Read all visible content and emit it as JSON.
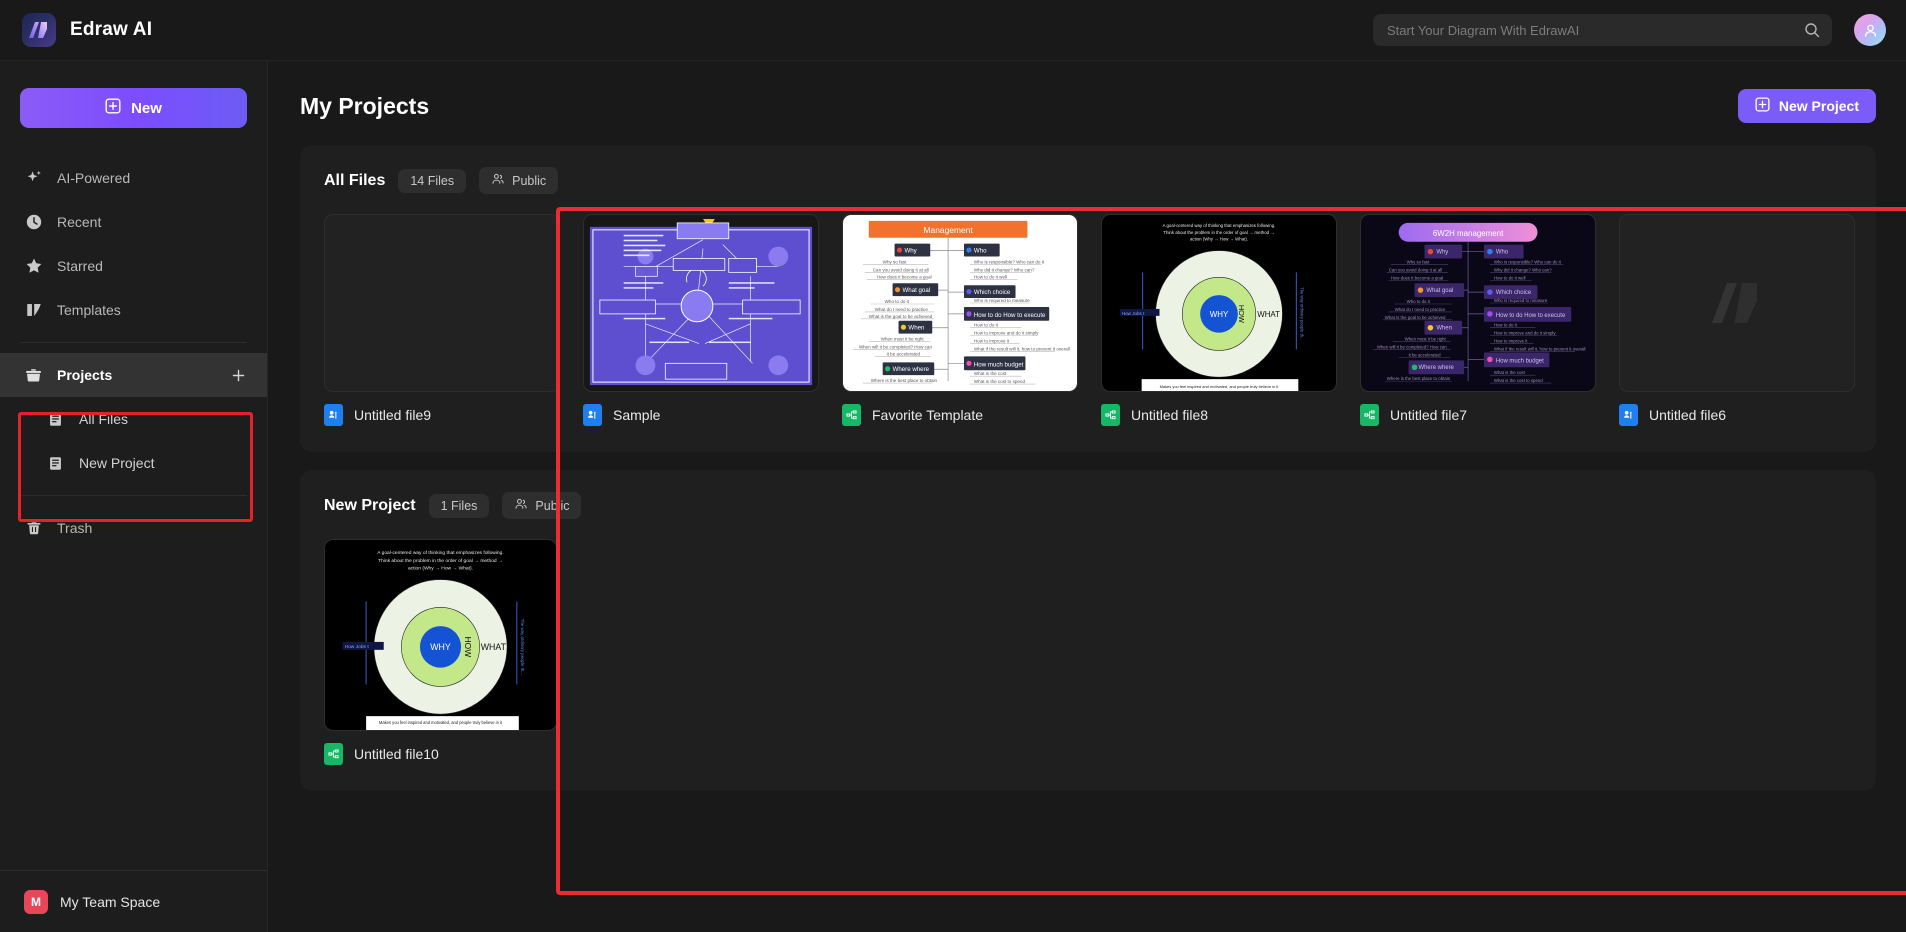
{
  "app": {
    "brand_name": "Edraw AI",
    "logo_icon": "edraw-logo-icon"
  },
  "header": {
    "search": {
      "placeholder": "Start Your Diagram With EdrawAI",
      "value": "",
      "icon": "search-icon"
    },
    "avatar_icon": "user-avatar-icon"
  },
  "sidebar": {
    "new_button": {
      "label": "New",
      "icon": "plus-box-icon"
    },
    "items": [
      {
        "label": "AI-Powered",
        "icon": "sparkle-icon",
        "active": false
      },
      {
        "label": "Recent",
        "icon": "clock-icon",
        "active": false
      },
      {
        "label": "Starred",
        "icon": "star-icon",
        "active": false
      },
      {
        "label": "Templates",
        "icon": "templates-icon",
        "active": false
      }
    ],
    "projects": {
      "label": "Projects",
      "icon": "folder-icon",
      "add_icon": "plus-icon",
      "active": true,
      "children": [
        {
          "label": "All Files",
          "icon": "file-list-icon"
        },
        {
          "label": "New Project",
          "icon": "file-list-icon"
        }
      ]
    },
    "trash": {
      "label": "Trash",
      "icon": "trash-icon"
    },
    "team": {
      "badge": "M",
      "label": "My Team Space"
    }
  },
  "main": {
    "page_title": "My Projects",
    "new_project_button": {
      "label": "New Project",
      "icon": "plus-box-icon"
    },
    "sections": [
      {
        "title": "All Files",
        "file_count_label": "14 Files",
        "visibility_label": "Public",
        "visibility_icon": "people-icon",
        "files": [
          {
            "name": "Untitled file9",
            "icon_type": "blue",
            "icon": "diagram-file-icon",
            "thumb": "empty"
          },
          {
            "name": "Sample",
            "icon_type": "blue",
            "icon": "diagram-file-icon",
            "thumb": "uml-collaboration"
          },
          {
            "name": "Favorite Template",
            "icon_type": "green",
            "icon": "mindmap-file-icon",
            "thumb": "management-mindmap"
          },
          {
            "name": "Untitled file8",
            "icon_type": "green",
            "icon": "mindmap-file-icon",
            "thumb": "golden-circle"
          },
          {
            "name": "Untitled file7",
            "icon_type": "green",
            "icon": "mindmap-file-icon",
            "thumb": "6w2h-mindmap"
          },
          {
            "name": "Untitled file6",
            "icon_type": "blue",
            "icon": "diagram-file-icon",
            "thumb": "watermark"
          }
        ]
      },
      {
        "title": "New Project",
        "file_count_label": "1 Files",
        "visibility_label": "Public",
        "visibility_icon": "people-icon",
        "files": [
          {
            "name": "Untitled file10",
            "icon_type": "green",
            "icon": "mindmap-file-icon",
            "thumb": "golden-circle-large"
          }
        ]
      }
    ]
  },
  "thumbnails": {
    "management_mindmap": {
      "root": "Management",
      "branches": [
        "Why",
        "Who",
        "What goal",
        "Which choice",
        "When",
        "How to do How to execute",
        "Where where",
        "How much budget"
      ]
    },
    "sixw2h_mindmap": {
      "root": "6W2H management",
      "branches": [
        "Why",
        "Who",
        "What goal",
        "Which choice",
        "When",
        "How to do How to execute",
        "Where where",
        "How much budget"
      ]
    },
    "golden_circle": {
      "caption": "A goal-centered way of thinking that emphasizes following. Think about the problem in the order of goal → method → action (Why → How → What).",
      "rings": [
        "WHY",
        "HOW",
        "WHAT"
      ],
      "left_label": "How Jobs i",
      "right_label": "The way ordinary people th..."
    }
  },
  "colors": {
    "accent_purple": "#7c5cf8",
    "annotation_red": "#f02a35",
    "file_blue": "#1d7ff0",
    "file_green": "#16b866",
    "team_red": "#e8475a"
  }
}
